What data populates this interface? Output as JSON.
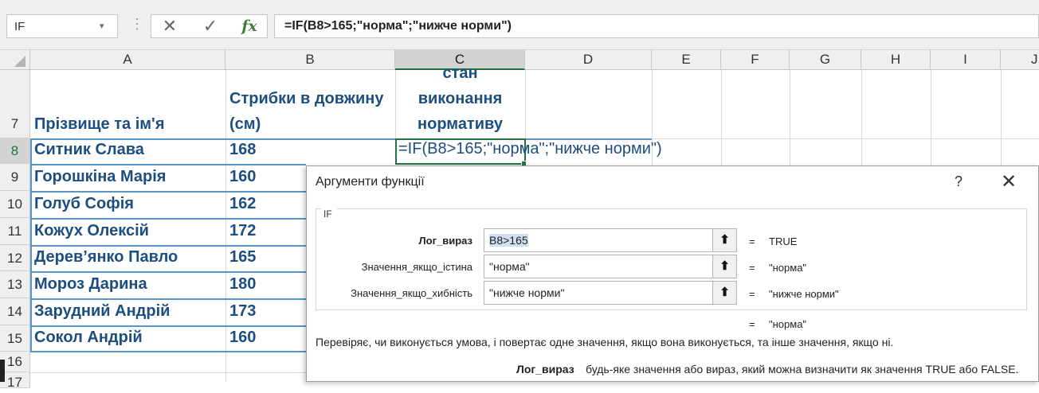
{
  "formula_bar": {
    "name_box": "IF",
    "fx_label": "fx",
    "cancel_glyph": "✕",
    "enter_glyph": "✓",
    "formula": "=IF(B8>165;\"норма\";\"нижче норми\")"
  },
  "columns": [
    "A",
    "B",
    "C",
    "D",
    "E",
    "F",
    "G",
    "H",
    "I",
    "J"
  ],
  "rows": [
    "7",
    "8",
    "9",
    "10",
    "11",
    "12",
    "13",
    "14",
    "15",
    "16",
    "17"
  ],
  "header_row": {
    "name": "Прізвище та ім'я",
    "jump_line1": "Стрибки в довжину",
    "jump_line2": "(см)",
    "status_line1": "стан",
    "status_line2": "виконання",
    "status_line3": "нормативу"
  },
  "students": [
    {
      "name": "Ситник Слава",
      "score": "168"
    },
    {
      "name": "Горошкіна Марія",
      "score": "160"
    },
    {
      "name": "Голуб Софія",
      "score": "162"
    },
    {
      "name": "Кожух Олексій",
      "score": "172"
    },
    {
      "name": "Дерев’янко Павло",
      "score": "165"
    },
    {
      "name": "Мороз Дарина",
      "score": "180"
    },
    {
      "name": "Зарудний Андрій",
      "score": "173"
    },
    {
      "name": "Сокол Андрій",
      "score": "160"
    }
  ],
  "active_cell": {
    "ref": "C8",
    "content": "=IF(B8>165;\"норма\";\"нижче норми\")"
  },
  "dialog": {
    "title": "Аргументи функції",
    "help": "?",
    "close": "✕",
    "function_name": "IF",
    "args": [
      {
        "label": "Лог_вираз",
        "value": "B8>165",
        "result": "TRUE",
        "bold": true
      },
      {
        "label": "Значення_якщо_істина",
        "value": "\"норма\"",
        "result": "\"норма\"",
        "bold": false
      },
      {
        "label": "Значення_якщо_хибність",
        "value": "\"нижче норми\"",
        "result": "\"нижче норми\"",
        "bold": false
      }
    ],
    "equals": "=",
    "formula_result": "\"норма\"",
    "description": "Перевіряє, чи виконується умова, і повертає одне значення, якщо вона виконується, та інше значення, якщо ні.",
    "arg_detail_name": "Лог_вираз",
    "arg_detail_text": "будь-яке значення або вираз, який можна визначити як значення TRUE або FALSE."
  },
  "colors": {
    "cell_text": "#1c4e80",
    "table_border": "#5a95c8",
    "selection": "#217346"
  }
}
